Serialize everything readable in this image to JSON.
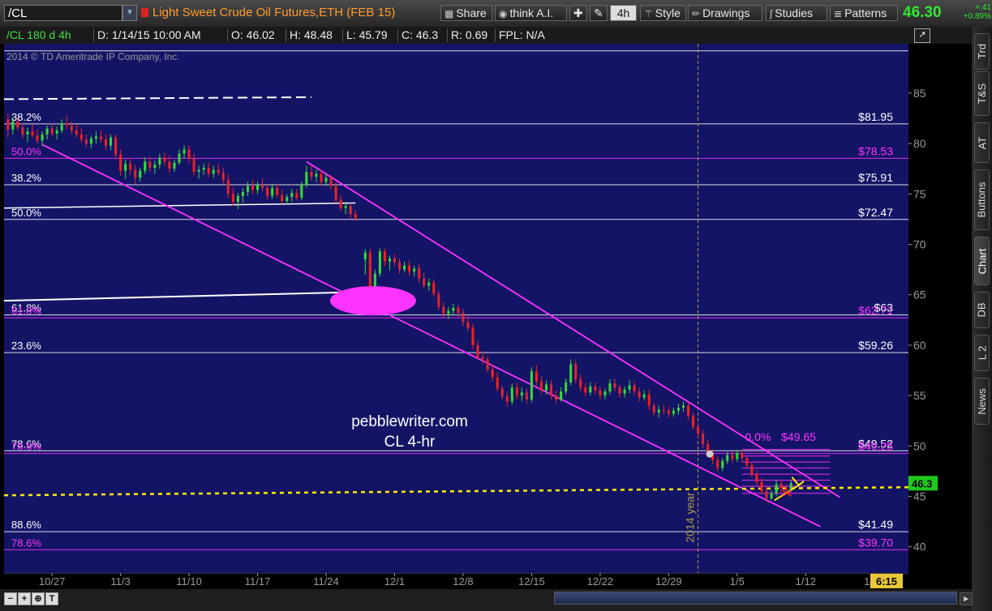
{
  "toolbar": {
    "symbol": "/CL",
    "description": "Light Sweet Crude Oil Futures,ETH (FEB 15)",
    "buttons": {
      "share": "Share",
      "think": "think A.I.",
      "timeframe": "4h",
      "style": "Style",
      "drawings": "Drawings",
      "studies": "Studies",
      "patterns": "Patterns"
    },
    "last_price": "46.30",
    "change": "+.41",
    "change_pct": "+0.89%"
  },
  "infobar": {
    "symbol": "/CL 180 d 4h",
    "date": "D: 1/14/15 10:00 AM",
    "open": "O: 46.02",
    "high": "H: 48.48",
    "low": "L: 45.79",
    "close": "C: 46.3",
    "range": "R: 0.69",
    "fpl": "FPL: N/A"
  },
  "right_tabs": [
    "Trd",
    "T&S",
    "AT",
    "Buttons",
    "Chart",
    "DB",
    "L 2",
    "News"
  ],
  "colors": {
    "plot_bg": "#141466",
    "white_line": "#ffffff",
    "magenta": "#ff33ff",
    "yellow": "#ffee00",
    "up": "#33dd33",
    "down": "#ee2222"
  },
  "chart_data": {
    "type": "candlestick",
    "copyright": "2014 © TD Ameritrade IP Company, Inc.",
    "watermark": [
      "pebblewriter.com",
      "CL 4-hr"
    ],
    "vline_label": "2014 year",
    "ylim": [
      37.4,
      89.9
    ],
    "y_ticks": [
      40,
      45,
      50,
      55,
      60,
      65,
      70,
      75,
      80,
      85
    ],
    "x_ticks": [
      {
        "label": "10/27",
        "day": 0
      },
      {
        "label": "11/3",
        "day": 7
      },
      {
        "label": "11/10",
        "day": 14
      },
      {
        "label": "11/17",
        "day": 21
      },
      {
        "label": "11/24",
        "day": 28
      },
      {
        "label": "12/1",
        "day": 35
      },
      {
        "label": "12/8",
        "day": 42
      },
      {
        "label": "12/15",
        "day": 49
      },
      {
        "label": "12/22",
        "day": 56
      },
      {
        "label": "12/29",
        "day": 63
      },
      {
        "label": "1/5",
        "day": 70
      },
      {
        "label": "1/12",
        "day": 77
      },
      {
        "label": "1/19",
        "day": 84
      }
    ],
    "xlim_days": [
      -4.9,
      87.5
    ],
    "time_label": "6:15",
    "price_label": "46.3",
    "fib_lines": [
      {
        "price": 81.95,
        "left": "38.2%",
        "right": "$81.95",
        "color": "white"
      },
      {
        "price": 78.53,
        "left": "50.0%",
        "right": "$78.53",
        "color": "magenta"
      },
      {
        "price": 75.91,
        "left": "38.2%",
        "right": "$75.91",
        "color": "white"
      },
      {
        "price": 72.47,
        "left": "50.0%",
        "right": "$72.47",
        "color": "white"
      },
      {
        "price": 63.0,
        "left": "61.8%",
        "right": "$63",
        "color": "white"
      },
      {
        "price": 62.71,
        "left": "61.8%",
        "right": "$62.71",
        "color": "magenta"
      },
      {
        "price": 59.26,
        "left": "23.6%",
        "right": "$59.26",
        "color": "white"
      },
      {
        "price": 49.52,
        "left": "78.6%",
        "right": "$49.52",
        "color": "white"
      },
      {
        "price": 49.25,
        "left": "78.6%",
        "right": "$49.25",
        "color": "magenta"
      },
      {
        "price": 41.49,
        "left": "88.6%",
        "right": "$41.49",
        "color": "white"
      },
      {
        "price": 39.7,
        "left": "78.6%",
        "right": "$39.70",
        "color": "magenta"
      }
    ],
    "small_fib": {
      "left": "0.0%",
      "right": "$49.65"
    },
    "candles": [
      [
        -4.5,
        82.4,
        83.0,
        80.6,
        81.4
      ],
      [
        -4.0,
        81.4,
        82.6,
        80.9,
        82.2
      ],
      [
        -3.5,
        82.2,
        82.7,
        81.3,
        81.6
      ],
      [
        -3.0,
        81.6,
        82.0,
        80.5,
        80.9
      ],
      [
        -2.5,
        80.9,
        81.6,
        80.1,
        81.2
      ],
      [
        -2.0,
        81.2,
        81.9,
        80.6,
        80.8
      ],
      [
        -1.5,
        80.8,
        81.4,
        80.0,
        80.3
      ],
      [
        -1.0,
        80.3,
        81.2,
        79.8,
        80.9
      ],
      [
        -0.5,
        80.9,
        81.8,
        80.4,
        81.5
      ],
      [
        0.0,
        81.5,
        82.0,
        80.7,
        81.0
      ],
      [
        0.5,
        81.0,
        81.7,
        80.4,
        81.3
      ],
      [
        1.0,
        81.3,
        82.4,
        81.0,
        82.0
      ],
      [
        1.5,
        82.0,
        82.8,
        81.4,
        81.8
      ],
      [
        2.0,
        81.8,
        82.2,
        80.9,
        81.3
      ],
      [
        2.5,
        81.3,
        81.9,
        80.6,
        80.9
      ],
      [
        3.0,
        80.9,
        81.5,
        80.1,
        80.4
      ],
      [
        3.5,
        80.4,
        80.9,
        79.6,
        80.0
      ],
      [
        4.0,
        80.0,
        80.8,
        79.5,
        80.5
      ],
      [
        4.5,
        80.5,
        81.2,
        80.0,
        80.7
      ],
      [
        5.0,
        80.7,
        81.3,
        80.1,
        80.4
      ],
      [
        5.5,
        80.4,
        80.9,
        79.4,
        79.8
      ],
      [
        6.0,
        79.8,
        80.9,
        79.3,
        80.6
      ],
      [
        6.5,
        80.6,
        80.9,
        78.5,
        78.9
      ],
      [
        7.0,
        78.9,
        79.4,
        76.8,
        77.3
      ],
      [
        7.5,
        77.3,
        78.4,
        76.5,
        78.0
      ],
      [
        8.0,
        78.0,
        78.6,
        76.9,
        77.4
      ],
      [
        8.5,
        77.4,
        77.9,
        76.0,
        76.6
      ],
      [
        9.0,
        76.6,
        77.6,
        76.2,
        77.3
      ],
      [
        9.5,
        77.3,
        78.6,
        77.0,
        78.2
      ],
      [
        10.0,
        78.2,
        78.7,
        77.2,
        77.6
      ],
      [
        10.5,
        77.6,
        78.3,
        77.0,
        77.9
      ],
      [
        11.0,
        77.9,
        79.0,
        77.5,
        78.6
      ],
      [
        11.5,
        78.6,
        79.1,
        77.8,
        78.2
      ],
      [
        12.0,
        78.2,
        78.8,
        77.1,
        77.5
      ],
      [
        12.5,
        77.5,
        78.4,
        77.2,
        78.1
      ],
      [
        13.0,
        78.1,
        79.4,
        77.9,
        79.0
      ],
      [
        13.5,
        79.0,
        79.8,
        78.5,
        79.4
      ],
      [
        14.0,
        79.4,
        79.8,
        78.1,
        78.5
      ],
      [
        14.5,
        78.5,
        79.0,
        76.8,
        77.2
      ],
      [
        15.0,
        77.2,
        77.8,
        76.5,
        77.4
      ],
      [
        15.5,
        77.4,
        78.0,
        76.9,
        77.6
      ],
      [
        16.0,
        77.6,
        78.1,
        76.7,
        77.0
      ],
      [
        16.5,
        77.0,
        77.8,
        76.6,
        77.4
      ],
      [
        17.0,
        77.4,
        78.0,
        76.8,
        77.1
      ],
      [
        17.5,
        77.1,
        77.6,
        76.0,
        76.4
      ],
      [
        18.0,
        76.4,
        76.9,
        74.6,
        75.0
      ],
      [
        18.5,
        75.0,
        75.6,
        73.8,
        74.2
      ],
      [
        19.0,
        74.2,
        75.1,
        73.5,
        74.8
      ],
      [
        19.5,
        74.8,
        75.6,
        74.1,
        75.2
      ],
      [
        20.0,
        75.2,
        76.2,
        74.8,
        75.8
      ],
      [
        20.5,
        75.8,
        76.4,
        75.0,
        75.4
      ],
      [
        21.0,
        75.4,
        76.2,
        75.0,
        75.9
      ],
      [
        21.5,
        75.9,
        76.6,
        75.2,
        75.6
      ],
      [
        22.0,
        75.6,
        76.0,
        74.4,
        74.8
      ],
      [
        22.5,
        74.8,
        76.0,
        74.5,
        75.6
      ],
      [
        23.0,
        75.6,
        76.0,
        74.6,
        74.9
      ],
      [
        23.5,
        74.9,
        75.4,
        74.0,
        74.3
      ],
      [
        24.0,
        74.3,
        75.0,
        73.9,
        74.7
      ],
      [
        24.5,
        74.7,
        75.5,
        74.2,
        75.1
      ],
      [
        25.0,
        75.1,
        75.5,
        74.3,
        74.6
      ],
      [
        25.5,
        74.6,
        76.2,
        74.4,
        75.9
      ],
      [
        26.0,
        75.9,
        77.8,
        75.6,
        77.2
      ],
      [
        26.5,
        77.2,
        77.8,
        76.3,
        76.7
      ],
      [
        27.0,
        76.7,
        77.4,
        76.2,
        77.0
      ],
      [
        27.5,
        77.0,
        77.4,
        75.8,
        76.2
      ],
      [
        28.0,
        76.2,
        77.0,
        75.8,
        76.6
      ],
      [
        28.5,
        76.6,
        76.9,
        75.4,
        75.8
      ],
      [
        29.0,
        75.8,
        76.2,
        74.1,
        74.4
      ],
      [
        29.5,
        74.4,
        74.9,
        73.3,
        73.6
      ],
      [
        30.0,
        73.6,
        74.2,
        73.0,
        73.8
      ],
      [
        30.5,
        73.8,
        74.1,
        72.6,
        73.0
      ],
      [
        31.0,
        73.0,
        73.4,
        72.3,
        72.6
      ],
      [
        32.0,
        68.5,
        69.5,
        67.0,
        69.2
      ],
      [
        32.5,
        69.2,
        69.6,
        64.0,
        64.8
      ],
      [
        33.0,
        64.8,
        67.5,
        64.4,
        67.1
      ],
      [
        33.5,
        67.1,
        69.6,
        66.8,
        69.3
      ],
      [
        34.0,
        69.3,
        69.6,
        67.8,
        68.3
      ],
      [
        34.5,
        68.3,
        68.9,
        67.4,
        68.6
      ],
      [
        35.0,
        68.6,
        69.0,
        67.9,
        68.2
      ],
      [
        35.5,
        68.2,
        68.6,
        67.1,
        67.5
      ],
      [
        36.0,
        67.5,
        68.3,
        67.2,
        67.9
      ],
      [
        36.5,
        67.9,
        68.4,
        66.9,
        67.3
      ],
      [
        37.0,
        67.3,
        67.9,
        66.8,
        67.6
      ],
      [
        37.5,
        67.6,
        68.1,
        66.2,
        66.6
      ],
      [
        38.0,
        66.6,
        67.2,
        65.6,
        65.9
      ],
      [
        38.5,
        65.9,
        66.6,
        65.4,
        66.2
      ],
      [
        39.0,
        66.2,
        66.5,
        64.8,
        65.1
      ],
      [
        39.5,
        65.1,
        65.4,
        63.4,
        63.8
      ],
      [
        40.0,
        63.8,
        64.3,
        62.7,
        63.1
      ],
      [
        40.5,
        63.1,
        63.8,
        62.6,
        63.4
      ],
      [
        41.0,
        63.4,
        64.1,
        62.9,
        63.7
      ],
      [
        41.5,
        63.7,
        64.0,
        62.8,
        63.2
      ],
      [
        42.0,
        63.2,
        63.6,
        61.9,
        62.3
      ],
      [
        42.5,
        62.3,
        62.9,
        61.4,
        61.7
      ],
      [
        43.0,
        61.7,
        62.1,
        59.6,
        60.0
      ],
      [
        43.5,
        60.0,
        60.4,
        58.5,
        58.8
      ],
      [
        44.0,
        58.8,
        59.4,
        58.1,
        58.6
      ],
      [
        44.5,
        58.6,
        58.9,
        57.3,
        57.6
      ],
      [
        45.0,
        57.6,
        58.0,
        56.4,
        56.8
      ],
      [
        45.5,
        56.8,
        57.3,
        55.4,
        55.7
      ],
      [
        46.0,
        55.7,
        56.0,
        54.6,
        54.9
      ],
      [
        46.5,
        54.9,
        55.4,
        53.9,
        54.4
      ],
      [
        47.0,
        54.4,
        56.2,
        54.1,
        55.8
      ],
      [
        47.5,
        55.8,
        56.3,
        54.6,
        55.0
      ],
      [
        48.0,
        55.0,
        55.8,
        54.4,
        55.3
      ],
      [
        48.5,
        55.3,
        55.7,
        54.2,
        54.6
      ],
      [
        49.0,
        54.6,
        57.8,
        54.3,
        57.4
      ],
      [
        49.5,
        57.4,
        58.0,
        56.0,
        56.4
      ],
      [
        50.0,
        56.4,
        56.9,
        55.1,
        55.5
      ],
      [
        50.5,
        55.5,
        56.5,
        55.1,
        56.1
      ],
      [
        51.0,
        56.1,
        56.5,
        54.6,
        55.0
      ],
      [
        51.5,
        55.0,
        55.5,
        54.2,
        54.6
      ],
      [
        52.0,
        54.6,
        55.8,
        54.4,
        55.4
      ],
      [
        52.5,
        55.4,
        56.7,
        55.1,
        56.3
      ],
      [
        53.0,
        56.3,
        58.6,
        56.0,
        58.1
      ],
      [
        53.5,
        58.1,
        58.5,
        56.2,
        56.6
      ],
      [
        54.0,
        56.6,
        57.1,
        55.4,
        55.8
      ],
      [
        54.5,
        55.8,
        56.2,
        54.9,
        55.3
      ],
      [
        55.0,
        55.3,
        56.3,
        55.0,
        55.9
      ],
      [
        55.5,
        55.9,
        56.3,
        55.1,
        55.5
      ],
      [
        56.0,
        55.5,
        55.9,
        54.6,
        55.0
      ],
      [
        56.5,
        55.0,
        55.7,
        54.6,
        55.4
      ],
      [
        57.0,
        55.4,
        56.6,
        55.1,
        56.2
      ],
      [
        57.5,
        56.2,
        56.7,
        55.4,
        55.8
      ],
      [
        58.0,
        55.8,
        56.1,
        54.8,
        55.2
      ],
      [
        58.5,
        55.2,
        55.9,
        54.8,
        55.6
      ],
      [
        59.0,
        55.6,
        56.5,
        55.2,
        56.0
      ],
      [
        59.5,
        56.0,
        56.4,
        55.0,
        55.4
      ],
      [
        60.0,
        55.4,
        55.8,
        54.4,
        54.8
      ],
      [
        60.5,
        54.8,
        55.5,
        54.5,
        55.1
      ],
      [
        61.0,
        55.1,
        55.6,
        53.6,
        54.0
      ],
      [
        61.5,
        54.0,
        54.3,
        53.0,
        53.3
      ],
      [
        62.0,
        53.3,
        54.0,
        52.8,
        53.6
      ],
      [
        62.5,
        53.6,
        54.1,
        53.1,
        53.5
      ],
      [
        63.0,
        53.5,
        53.9,
        52.8,
        53.2
      ],
      [
        63.5,
        53.2,
        53.8,
        52.9,
        53.5
      ],
      [
        64.0,
        53.5,
        54.2,
        53.1,
        53.8
      ],
      [
        64.5,
        53.8,
        54.4,
        53.4,
        54.0
      ],
      [
        65.0,
        54.0,
        54.3,
        52.6,
        53.0
      ],
      [
        65.5,
        53.0,
        53.3,
        51.6,
        51.9
      ],
      [
        66.0,
        51.9,
        52.3,
        50.8,
        51.2
      ],
      [
        66.5,
        51.2,
        51.6,
        49.8,
        50.2
      ],
      [
        67.0,
        50.2,
        50.6,
        48.9,
        49.3
      ],
      [
        67.5,
        49.3,
        49.7,
        48.2,
        48.6
      ],
      [
        68.0,
        48.6,
        49.0,
        47.5,
        47.8
      ],
      [
        68.5,
        47.8,
        48.8,
        47.5,
        48.5
      ],
      [
        69.0,
        48.5,
        49.4,
        48.2,
        49.1
      ],
      [
        69.5,
        49.1,
        49.5,
        48.3,
        48.7
      ],
      [
        70.0,
        48.7,
        49.6,
        48.4,
        49.3
      ],
      [
        70.5,
        49.3,
        49.6,
        48.4,
        48.8
      ],
      [
        71.0,
        48.8,
        49.1,
        47.8,
        48.1
      ],
      [
        71.5,
        48.1,
        48.4,
        46.9,
        47.2
      ],
      [
        72.0,
        47.2,
        47.6,
        46.1,
        46.4
      ],
      [
        72.5,
        46.4,
        46.8,
        45.2,
        45.5
      ],
      [
        73.0,
        45.5,
        45.9,
        44.4,
        44.8
      ],
      [
        73.5,
        44.8,
        45.6,
        44.6,
        45.3
      ],
      [
        74.0,
        45.3,
        46.6,
        45.0,
        46.2
      ],
      [
        74.5,
        46.2,
        46.6,
        45.4,
        45.8
      ],
      [
        75.0,
        45.8,
        46.2,
        45.3,
        45.6
      ],
      [
        75.5,
        45.6,
        46.6,
        45.4,
        46.3
      ]
    ]
  }
}
